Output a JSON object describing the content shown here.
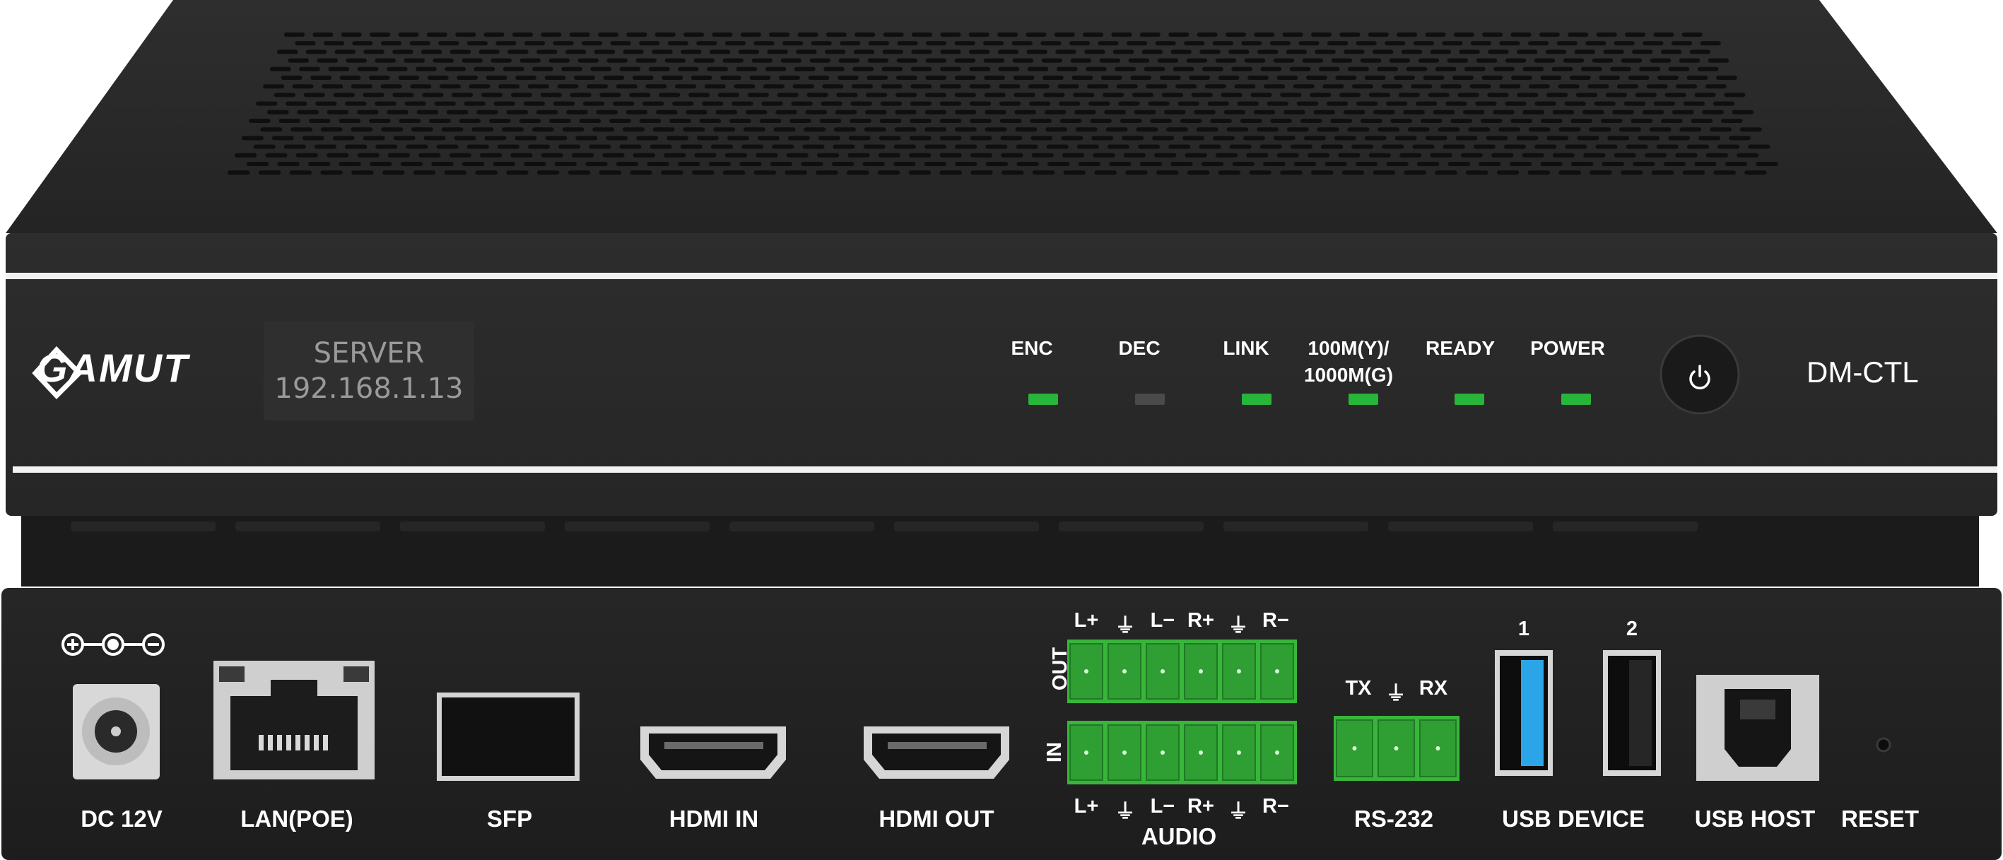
{
  "front_panel": {
    "brand": "GAMUT",
    "display": {
      "line1": "SERVER",
      "line2": "192.168.1.13"
    },
    "leds": [
      {
        "label": "ENC",
        "state": "on"
      },
      {
        "label": "DEC",
        "state": "off"
      },
      {
        "label": "LINK",
        "state": "on"
      },
      {
        "label": "100M(Y)/\n1000M(G)",
        "state": "on"
      },
      {
        "label": "READY",
        "state": "on"
      },
      {
        "label": "POWER",
        "state": "on"
      }
    ],
    "power_button_icon": "power-icon",
    "model": "DM-CTL"
  },
  "rear_panel": {
    "dc_polarity_icon": "dc-polarity-icon",
    "audio_pins": [
      "L+",
      "⏚",
      "L−",
      "R+",
      "⏚",
      "R−"
    ],
    "audio_out_label": "OUT",
    "audio_in_label": "IN",
    "rs232_pins": [
      "TX",
      "⏚",
      "RX"
    ],
    "usb_numbers": [
      "1",
      "2"
    ],
    "port_labels": {
      "dc": "DC 12V",
      "lan": "LAN(POE)",
      "sfp": "SFP",
      "hdmi_in": "HDMI IN",
      "hdmi_out": "HDMI OUT",
      "audio": "AUDIO",
      "rs232": "RS-232",
      "usb_device": "USB DEVICE",
      "usb_host": "USB HOST",
      "reset": "RESET"
    }
  },
  "colors": {
    "chassis": "#2b2b2b",
    "chassis_dark": "#1a1a1a",
    "led_green": "#27b53a",
    "led_off": "#4a4a4a",
    "terminal_green": "#38b63a",
    "usb_blue": "#2aa6e8"
  }
}
